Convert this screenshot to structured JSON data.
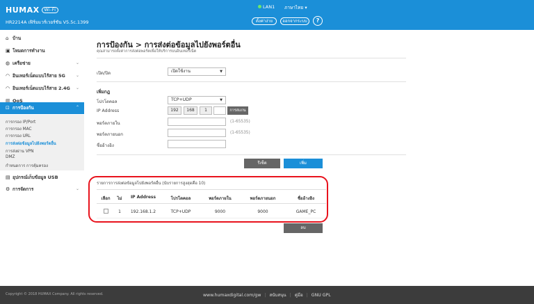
{
  "header": {
    "brand": "HUMAX",
    "wifi_badge": "Wi-Fi",
    "model": "HR2214A  เฟิร์มแวร์เวอร์ชัน  V5.5c.1399",
    "lan": "LAN1",
    "language": "ภาษาไทย",
    "change_pw": "ตั้งค่าง่าย",
    "logout": "ออกจากระบบ",
    "help": "?"
  },
  "sidebar": {
    "items": [
      {
        "label": "บ้าน",
        "icon": "home-icon"
      },
      {
        "label": "โหมดการทำงาน",
        "icon": "mode-icon"
      },
      {
        "label": "เครือข่าย",
        "icon": "globe-icon"
      },
      {
        "label": "อินเทอร์เน็ตแบบไร้สาย 5G",
        "icon": "wifi-icon"
      },
      {
        "label": "อินเทอร์เน็ตแบบไร้สาย 2.4G",
        "icon": "wifi-icon"
      },
      {
        "label": "QoS",
        "icon": "bar-chart-icon"
      },
      {
        "label": "การป้องกัน",
        "icon": "lock-icon"
      },
      {
        "label": "อุปกรณ์เก็บข้อมูล USB",
        "icon": "usb-icon"
      },
      {
        "label": "การจัดการ",
        "icon": "gear-icon"
      }
    ],
    "sub_items": [
      "การกรอง IP/Port",
      "การกรอง MAC",
      "การกรอง URL",
      "การส่งต่อข้อมูลไปยังพอร์ตอื่น",
      "การส่งผ่าน VPN",
      "DMZ",
      "กำหนดการ การคุ้มครอง"
    ]
  },
  "main": {
    "title": "การป้องกัน > การส่งต่อข้อมูลไปยังพอร์ตอื่น",
    "subtitle": "คุณสามารถตั้งค่าการส่งต่อพอร์ตเพื่อให้บริการบนอินเทอร์เน็ต",
    "enable_label": "เปิด/ปิด",
    "enable_value": "เปิดใช้งาน",
    "add_section": "เพิ่มกฎ",
    "protocol_label": "โปรโตคอล",
    "protocol_value": "TCP+UDP",
    "ip_label": "IP Address",
    "ip_octets": [
      "192",
      "168",
      "1",
      ""
    ],
    "scan_button": "การสแกน",
    "internal_port_label": "พอร์ตภายใน",
    "internal_port_hint": "(1-65535)",
    "external_port_label": "พอร์ตภายนอก",
    "external_port_hint": "(1-65535)",
    "name_label": "ชื่ออ้างอิง",
    "reset_button": "รีเซ็ต",
    "add_button": "เพิ่ม",
    "list_title": "รายการการส่งต่อข้อมูลไปยังพอร์ตอื่น  (นับรายการสูงสุดคือ 10)",
    "columns": [
      "เลือก",
      "ไม่",
      "IP Address",
      "โปรโตคอล",
      "พอร์ตภายใน",
      "พอร์ตภายนอก",
      "ชื่ออ้างอิง"
    ],
    "rows": [
      {
        "no": "1",
        "ip": "192.168.1.2",
        "protocol": "TCP+UDP",
        "internal": "9000",
        "external": "9000",
        "name": "GAME_PC"
      }
    ],
    "delete_button": "ลบ"
  },
  "footer": {
    "copyright": "Copyright © 2018 HUMAX Company. All rights reserved.",
    "website": "www.humaxdigital.com/gw",
    "support": "สนับสนุน",
    "manual": "คู่มือ",
    "gpl": "GNU GPL"
  },
  "colors": {
    "accent": "#1b8fd8",
    "highlight": "#e8121c",
    "footer": "#3c3c3c"
  }
}
